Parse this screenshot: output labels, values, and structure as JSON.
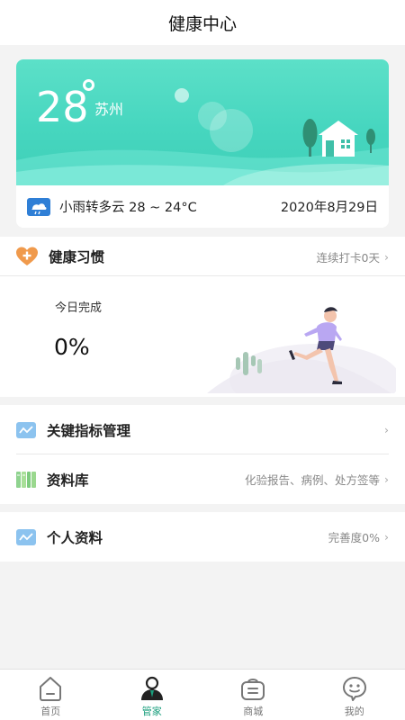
{
  "header": {
    "title": "健康中心"
  },
  "weather": {
    "temperature": "28",
    "city": "苏州",
    "description": "小雨转多云 28 ~ 24°C",
    "date": "2020年8月29日"
  },
  "habits": {
    "title": "健康习惯",
    "streak": "连续打卡0天",
    "today_label": "今日完成",
    "today_value": "0%"
  },
  "metrics": {
    "key_indicators": {
      "label": "关键指标管理"
    },
    "library": {
      "label": "资料库",
      "hint": "化验报告、病例、处方签等"
    }
  },
  "profile": {
    "label": "个人资料",
    "hint": "完善度0%"
  },
  "nav": {
    "items": [
      {
        "label": "首页",
        "icon": "home-icon"
      },
      {
        "label": "管家",
        "icon": "butler-icon"
      },
      {
        "label": "商城",
        "icon": "shop-icon"
      },
      {
        "label": "我的",
        "icon": "profile-icon"
      }
    ],
    "active_color": "#1a9e7d"
  },
  "colors": {
    "accent": "#46d6bf",
    "brand": "#1a9e7d"
  }
}
